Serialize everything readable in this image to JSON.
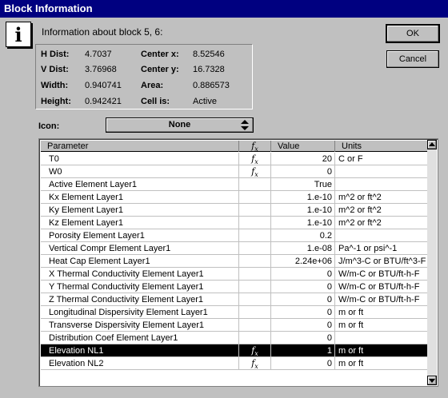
{
  "window": {
    "title": "Block Information"
  },
  "header": {
    "info_text": "Information about block 5, 6:"
  },
  "buttons": {
    "ok": "OK",
    "cancel": "Cancel"
  },
  "stats": {
    "h_dist_label": "H Dist:",
    "h_dist": "4.7037",
    "v_dist_label": "V Dist:",
    "v_dist": "3.76968",
    "width_label": "Width:",
    "width": "0.940741",
    "height_label": "Height:",
    "height": "0.942421",
    "center_x_label": "Center x:",
    "center_x": "8.52546",
    "center_y_label": "Center y:",
    "center_y": "16.7328",
    "area_label": "Area:",
    "area": "0.886573",
    "cell_label": "Cell is:",
    "cell": "Active"
  },
  "icon_select": {
    "label": "Icon:",
    "value": "None"
  },
  "table": {
    "headers": {
      "parameter": "Parameter",
      "value": "Value",
      "units": "Units"
    },
    "rows": [
      {
        "param": "T0",
        "fx": true,
        "value": "20",
        "units": "C or F"
      },
      {
        "param": "W0",
        "fx": true,
        "value": "0",
        "units": ""
      },
      {
        "param": "Active Element Layer1",
        "fx": false,
        "value": "True",
        "units": ""
      },
      {
        "param": "Kx Element Layer1",
        "fx": false,
        "value": "1.e-10",
        "units": "m^2 or ft^2"
      },
      {
        "param": "Ky Element Layer1",
        "fx": false,
        "value": "1.e-10",
        "units": "m^2 or ft^2"
      },
      {
        "param": "Kz Element Layer1",
        "fx": false,
        "value": "1.e-10",
        "units": "m^2 or ft^2"
      },
      {
        "param": "Porosity Element Layer1",
        "fx": false,
        "value": "0.2",
        "units": ""
      },
      {
        "param": "Vertical Compr Element Layer1",
        "fx": false,
        "value": "1.e-08",
        "units": "Pa^-1 or psi^-1"
      },
      {
        "param": "Heat Cap Element Layer1",
        "fx": false,
        "value": "2.24e+06",
        "units": "J/m^3-C or BTU/ft^3-F"
      },
      {
        "param": "X Thermal Conductivity Element Layer1",
        "fx": false,
        "value": "0",
        "units": "W/m-C or BTU/ft-h-F"
      },
      {
        "param": "Y Thermal Conductivity Element Layer1",
        "fx": false,
        "value": "0",
        "units": "W/m-C or BTU/ft-h-F"
      },
      {
        "param": "Z Thermal Conductivity Element Layer1",
        "fx": false,
        "value": "0",
        "units": "W/m-C or BTU/ft-h-F"
      },
      {
        "param": "Longitudinal Dispersivity Element Layer1",
        "fx": false,
        "value": "0",
        "units": "m or ft"
      },
      {
        "param": "Transverse Dispersivity Element Layer1",
        "fx": false,
        "value": "0",
        "units": "m or ft"
      },
      {
        "param": "Distribution Coef Element Layer1",
        "fx": false,
        "value": "0",
        "units": ""
      },
      {
        "param": "Elevation NL1",
        "fx": true,
        "value": "1",
        "units": "m or ft",
        "selected": true
      },
      {
        "param": "Elevation NL2",
        "fx": true,
        "value": "0",
        "units": "m or ft"
      }
    ]
  }
}
